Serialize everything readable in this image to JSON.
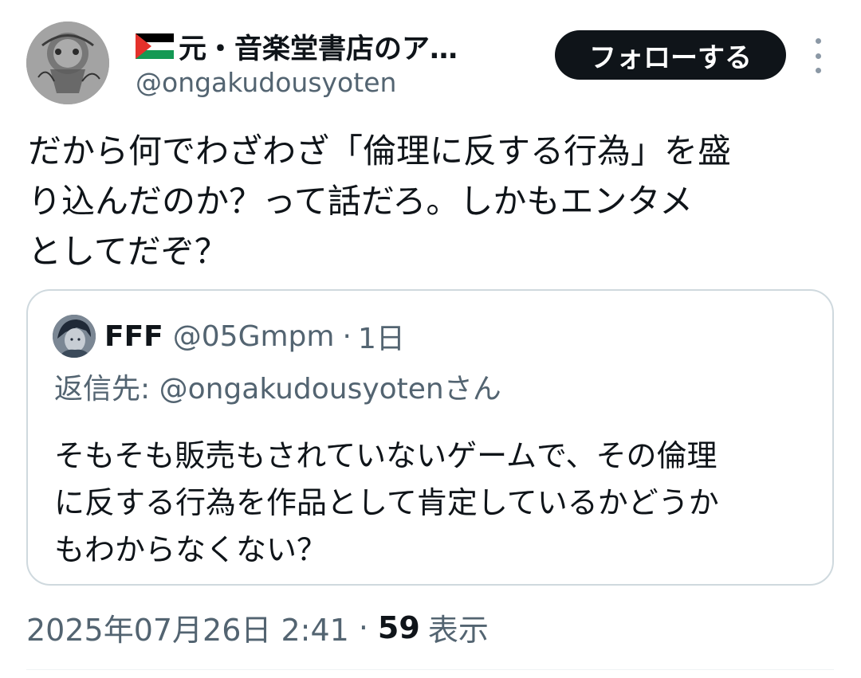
{
  "author": {
    "flag_icon": "palestine-flag-icon",
    "display_name": "元・音楽堂書店のア…",
    "handle": "@ongakudousyoten"
  },
  "follow_button": {
    "label": "フォローする"
  },
  "more_icon": "more-vertical-icon",
  "tweet": {
    "lines": [
      "だから何でわざわざ「倫理に反する行為」を盛",
      "り込んだのか？って話だろ。しかもエンタメ",
      "としてだぞ？"
    ]
  },
  "quote": {
    "name": "FFF",
    "handle": "@05Gmpm",
    "dot": "·",
    "time": "1日",
    "reply_prefix": "返信先: ",
    "reply_mention": "@ongakudousyotenさん",
    "lines": [
      "そもそも販売もされていないゲームで、その倫理",
      "に反する行為を作品として肯定しているかどうか",
      "もわからなくない？"
    ]
  },
  "meta": {
    "timestamp": "2025年07月26日 2:41",
    "sep": "·",
    "views_count": "59",
    "views_label": "表示"
  },
  "colors": {
    "text_primary": "#0f1419",
    "text_secondary": "#536471",
    "border": "#cfd9de",
    "button_bg": "#0f1419"
  }
}
